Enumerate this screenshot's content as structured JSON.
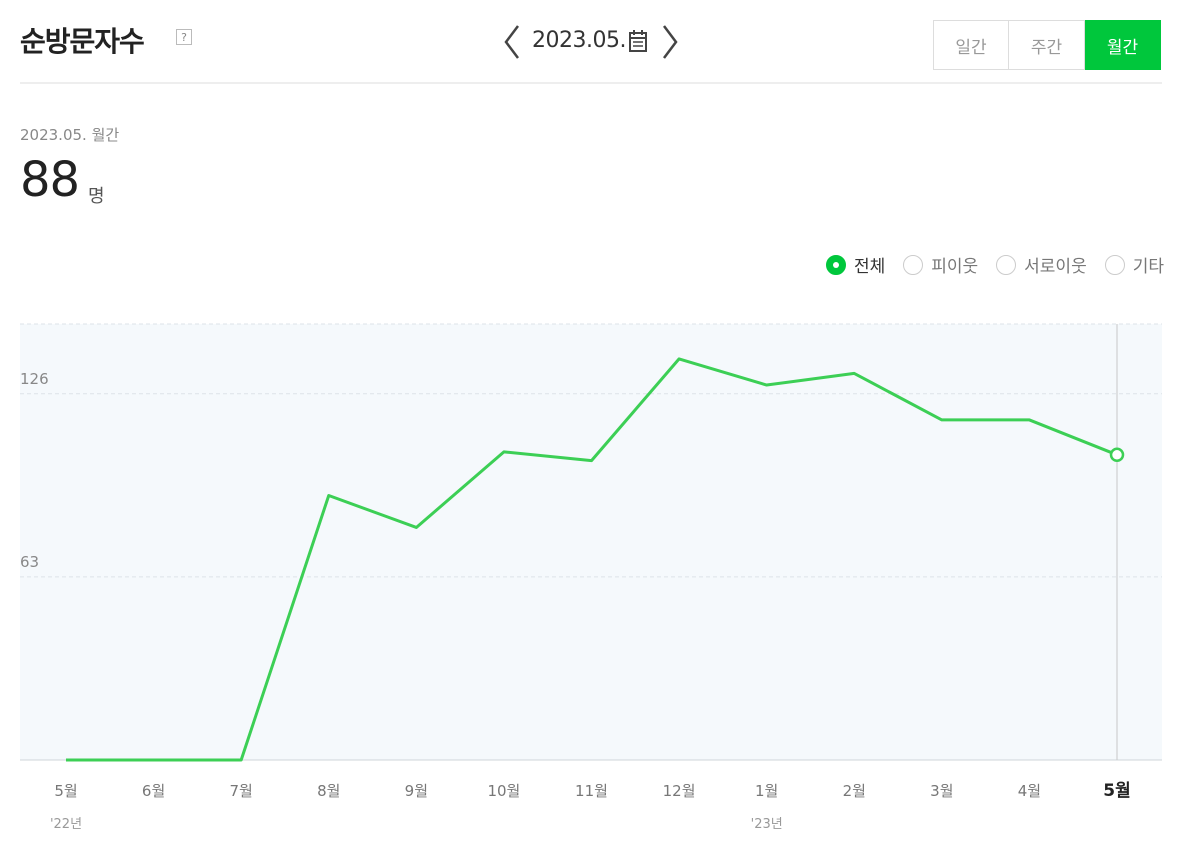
{
  "header": {
    "title": "순방문자수",
    "help_icon": "question-icon",
    "date_label": "2023.05.",
    "calendar_icon": "calendar-icon",
    "tabs": [
      {
        "label": "일간",
        "active": false
      },
      {
        "label": "주간",
        "active": false
      },
      {
        "label": "월간",
        "active": true
      }
    ]
  },
  "summary": {
    "period_label": "2023.05. 월간",
    "value": "88",
    "unit": "명"
  },
  "filters": [
    {
      "label": "전체",
      "checked": true
    },
    {
      "label": "피이웃",
      "checked": false
    },
    {
      "label": "서로이웃",
      "checked": false
    },
    {
      "label": "기타",
      "checked": false
    }
  ],
  "colors": {
    "accent": "#00c73c",
    "line": "#3ccf55",
    "plot_bg": "#f5f9fc"
  },
  "chart_data": {
    "type": "line",
    "categories": [
      "5월",
      "6월",
      "7월",
      "8월",
      "9월",
      "10월",
      "11월",
      "12월",
      "1월",
      "2월",
      "3월",
      "4월",
      "5월"
    ],
    "year_labels": [
      {
        "index": 0,
        "label": "'22년"
      },
      {
        "index": 8,
        "label": "'23년"
      }
    ],
    "values": [
      0,
      0,
      0,
      91,
      80,
      106,
      103,
      138,
      129,
      133,
      117,
      117,
      105
    ],
    "ylim": [
      0,
      150
    ],
    "yticks": [
      63,
      126
    ],
    "grid": true,
    "highlight_index": 12
  }
}
